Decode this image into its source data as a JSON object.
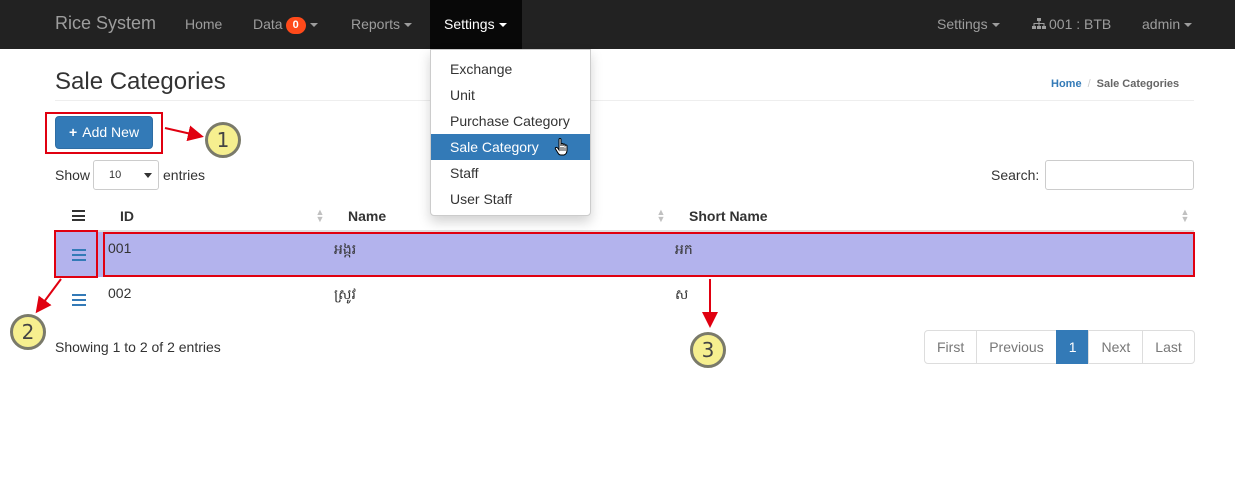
{
  "navbar": {
    "brand": "Rice System",
    "items": [
      {
        "label": "Home"
      },
      {
        "label": "Data",
        "badge": "0"
      },
      {
        "label": "Reports"
      },
      {
        "label": "Settings"
      }
    ],
    "right": {
      "settings_label": "Settings",
      "branch_label": "001 : BTB",
      "user_label": "admin"
    }
  },
  "settings_menu": {
    "items": [
      {
        "label": "Exchange"
      },
      {
        "label": "Unit"
      },
      {
        "label": "Purchase Category"
      },
      {
        "label": "Sale Category",
        "active": true
      },
      {
        "label": "Staff"
      },
      {
        "label": "User Staff"
      }
    ]
  },
  "page": {
    "title": "Sale Categories",
    "breadcrumb": {
      "home": "Home",
      "current": "Sale Categories"
    },
    "add_button": "Add New"
  },
  "table_controls": {
    "show_label": "Show",
    "page_length": "10",
    "entries_label": "entries",
    "search_label": "Search:",
    "search_value": ""
  },
  "table": {
    "columns": [
      "ID",
      "Name",
      "Short Name"
    ],
    "rows": [
      {
        "id": "001",
        "name": "អង្ករ",
        "short_name": "អក",
        "selected": true
      },
      {
        "id": "002",
        "name": "ស្រូវ",
        "short_name": "ស",
        "selected": false
      }
    ],
    "info": "Showing 1 to 2 of 2 entries"
  },
  "pagination": {
    "first": "First",
    "previous": "Previous",
    "current": "1",
    "next": "Next",
    "last": "Last"
  },
  "annotations": {
    "callouts": [
      "1",
      "2",
      "3"
    ],
    "highlight_color": "#e00010",
    "callout_color": "#f6ef8f"
  },
  "colors": {
    "navbar": "#222222",
    "primary": "#337ab7",
    "selected_row": "#b3b3ed",
    "badge": "#ff4a1a"
  }
}
